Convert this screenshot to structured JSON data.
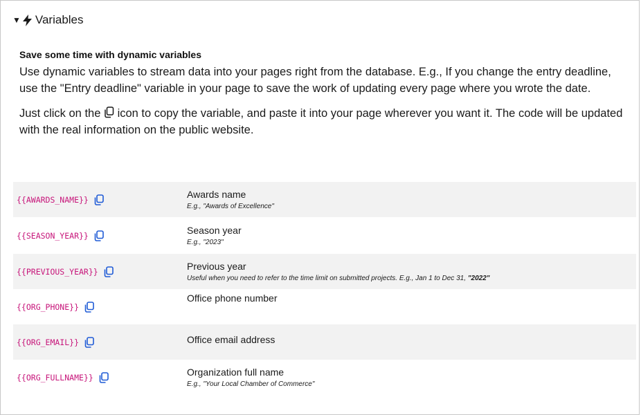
{
  "section": {
    "title": "Variables",
    "heading": "Save some time with dynamic variables",
    "paragraph1": "Use dynamic variables to stream data into your pages right from the database. E.g., If you change the entry deadline, use the \"Entry deadline\" variable in your page to save the work of updating every page where you wrote the date.",
    "paragraph2_before": "Just click on the ",
    "paragraph2_after": " icon to copy the variable, and paste it into your page wherever you want it. The code will be updated with the real information on the public website."
  },
  "variables": [
    {
      "code": "{{AWARDS_NAME}}",
      "title": "Awards name",
      "example": "E.g., \"Awards of Excellence\"",
      "example_bold": ""
    },
    {
      "code": "{{SEASON_YEAR}}",
      "title": "Season year",
      "example": "E.g., \"2023\"",
      "example_bold": ""
    },
    {
      "code": "{{PREVIOUS_YEAR}}",
      "title": "Previous year",
      "example": "Useful when you need to refer to the time limit on submitted projects. E.g., Jan 1 to Dec 31, ",
      "example_bold": "\"2022\""
    },
    {
      "code": "{{ORG_PHONE}}",
      "title": "Office phone number",
      "example": "",
      "example_bold": ""
    },
    {
      "code": "{{ORG_EMAIL}}",
      "title": "Office email address",
      "example": "",
      "example_bold": ""
    },
    {
      "code": "{{ORG_FULLNAME}}",
      "title": "Organization full name",
      "example": "E.g., \"Your Local Chamber of Commerce\"",
      "example_bold": ""
    }
  ],
  "icons": {
    "toggle": "triangle-down-icon",
    "bolt": "lightning-bolt-icon",
    "copy": "copy-icon"
  },
  "colors": {
    "code": "#c7157a",
    "copy_icon": "#1f5bd6",
    "row_stripe": "#f2f2f2"
  }
}
